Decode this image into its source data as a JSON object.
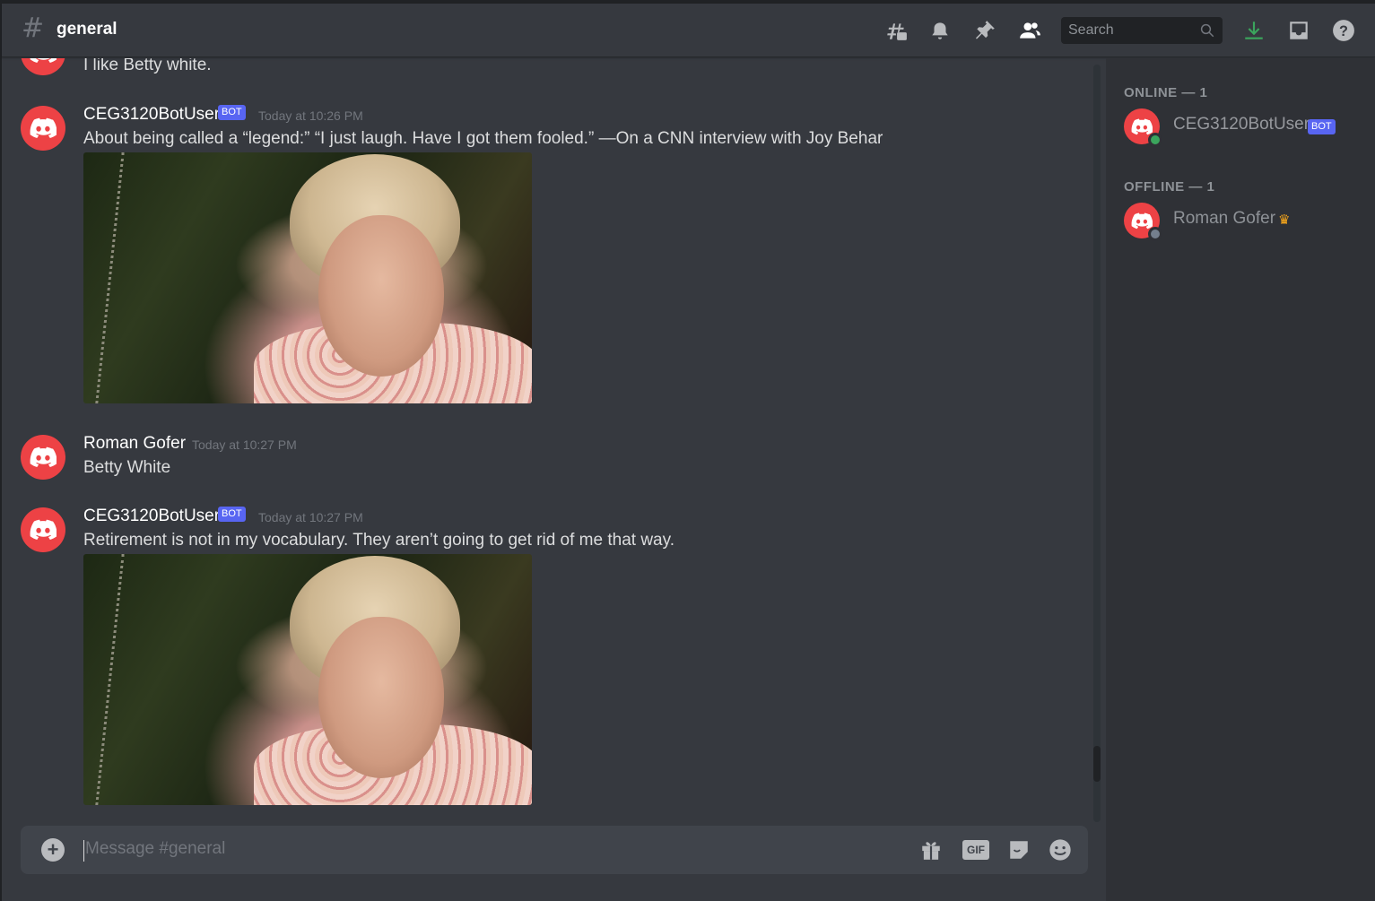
{
  "header": {
    "channel": "general",
    "search_placeholder": "Search"
  },
  "messages": [
    {
      "text": "I like Betty white."
    },
    {
      "author": "CEG3120BotUser",
      "badge": "BOT",
      "timestamp": "Today at 10:26 PM",
      "text": "About being called a “legend:” “I just laugh. Have I got them fooled.” —On a CNN interview with Joy Behar"
    },
    {
      "author": "Roman Gofer",
      "timestamp": "Today at 10:27 PM",
      "text": "Betty White"
    },
    {
      "author": "CEG3120BotUser",
      "badge": "BOT",
      "timestamp": "Today at 10:27 PM",
      "text": "Retirement is not in my vocabulary. They aren’t going to get rid of me that way."
    }
  ],
  "composer": {
    "placeholder": "Message #general"
  },
  "members": {
    "online_header": "ONLINE — 1",
    "offline_header": "OFFLINE — 1",
    "online": [
      {
        "name": "CEG3120BotUser",
        "badge": "BOT",
        "status_color": "#3ba55d"
      }
    ],
    "offline": [
      {
        "name": "Roman Gofer",
        "status_color": "#747f8d"
      }
    ]
  },
  "colors": {
    "accent": "#5865f2",
    "avatar": "#ed4245",
    "download": "#3ba55d",
    "crown": "#faa81a"
  }
}
